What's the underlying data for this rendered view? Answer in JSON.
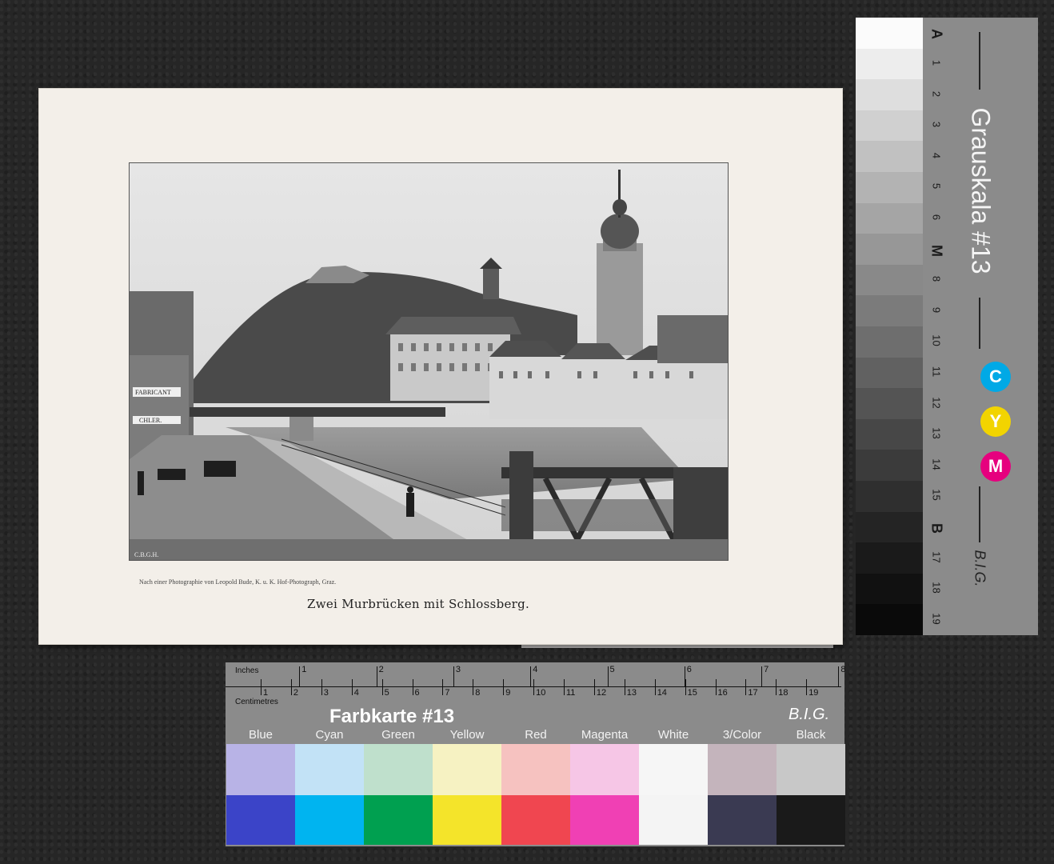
{
  "print": {
    "credit": "Nach einer Photographie von Leopold Bude, K. u. K. Hof-Photograph, Graz.",
    "caption": "Zwei Murbrücken mit Schlossberg.",
    "sign_text": "FABRICANT",
    "sign_text2": "CHLER.",
    "signature": "C.B.G.H."
  },
  "gray_scale": {
    "title": "Grauskala #13",
    "brand": "B.I.G.",
    "labels": [
      "A",
      "1",
      "2",
      "3",
      "4",
      "5",
      "6",
      "M",
      "8",
      "9",
      "10",
      "11",
      "12",
      "13",
      "14",
      "15",
      "B",
      "17",
      "18",
      "19"
    ],
    "steps": [
      "#fbfbfb",
      "#ededed",
      "#dedede",
      "#d0d0d0",
      "#c1c1c1",
      "#b3b3b3",
      "#a5a5a5",
      "#979797",
      "#898989",
      "#7b7b7b",
      "#6e6e6e",
      "#616161",
      "#545454",
      "#474747",
      "#3b3b3b",
      "#2f2f2f",
      "#242424",
      "#1a1a1a",
      "#111111",
      "#0a0a0a"
    ],
    "cym": [
      {
        "letter": "C",
        "color": "#00a9e6"
      },
      {
        "letter": "Y",
        "color": "#f2d400"
      },
      {
        "letter": "M",
        "color": "#e6007e"
      }
    ]
  },
  "color_card": {
    "title": "Farbkarte #13",
    "brand": "B.I.G.",
    "inches_label": "Inches",
    "cm_label": "Centimetres",
    "inches": [
      "1",
      "2",
      "3",
      "4",
      "5",
      "6",
      "7",
      "8"
    ],
    "cm": [
      "1",
      "2",
      "3",
      "4",
      "5",
      "6",
      "7",
      "8",
      "9",
      "10",
      "11",
      "12",
      "13",
      "14",
      "15",
      "16",
      "17",
      "18",
      "19"
    ],
    "swatches": [
      {
        "name": "Blue",
        "light": "#b8b3e6",
        "dark": "#3b44c8"
      },
      {
        "name": "Cyan",
        "light": "#c2e2f6",
        "dark": "#00b4f0"
      },
      {
        "name": "Green",
        "light": "#bfe0cc",
        "dark": "#00a050"
      },
      {
        "name": "Yellow",
        "light": "#f6f2c2",
        "dark": "#f4e42a"
      },
      {
        "name": "Red",
        "light": "#f6c2c0",
        "dark": "#f04650"
      },
      {
        "name": "Magenta",
        "light": "#f6c6e6",
        "dark": "#f040b4"
      },
      {
        "name": "White",
        "light": "#f6f6f6",
        "dark": "#f4f4f4"
      },
      {
        "name": "3/Color",
        "light": "#c4b4bc",
        "dark": "#3a3a52"
      },
      {
        "name": "Black",
        "light": "#c8c8c8",
        "dark": "#1a1a1a"
      }
    ]
  }
}
